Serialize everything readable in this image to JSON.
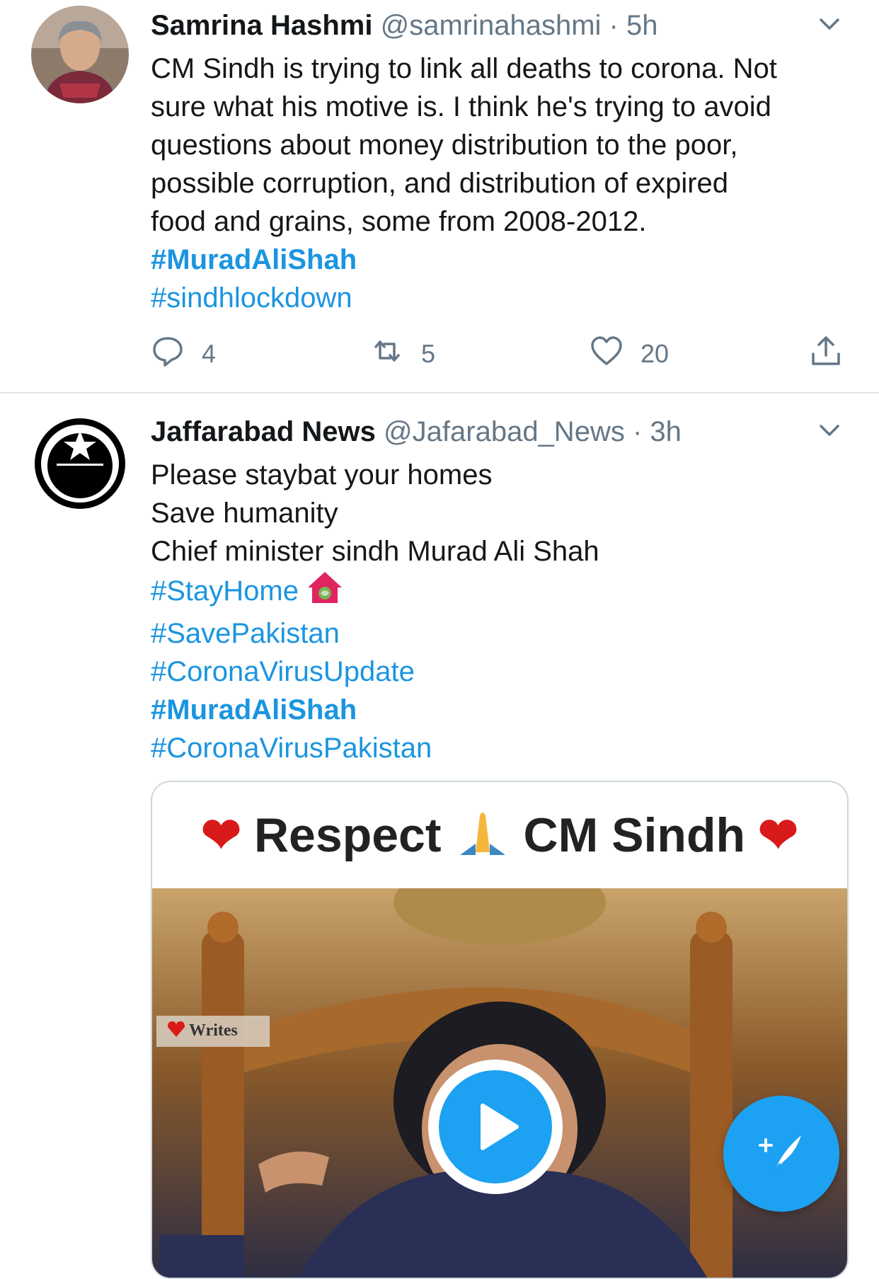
{
  "tweets": [
    {
      "name": "Samrina Hashmi",
      "handle": "@samrinahashmi",
      "separator": "·",
      "time": "5h",
      "lines": [
        "CM Sindh is trying to link all deaths to corona. Not",
        "sure what his motive is. I think he's trying to avoid",
        "questions about money distribution to the poor,",
        "possible corruption, and distribution of expired",
        "food and grains, some from 2008-2012."
      ],
      "hashtags": [
        "#MuradAliShah",
        "#sindhlockdown"
      ],
      "reply_count": "4",
      "retweet_count": "5",
      "like_count": "20"
    },
    {
      "name": "Jaffarabad News",
      "handle": "@Jafarabad_News",
      "separator": "·",
      "time": "3h",
      "lines": [
        "Please staybat your homes",
        "Save humanity",
        "Chief minister sindh Murad Ali Shah"
      ],
      "hashtags": [
        "#StayHome",
        "#SavePakistan",
        "#CoronaVirusUpdate",
        "#MuradAliShah",
        "#CoronaVirusPakistan"
      ],
      "media": {
        "title_word1": "Respect",
        "title_word2": "CM Sindh",
        "watermark": "Writes"
      }
    }
  ],
  "colors": {
    "link": "#1b95e0",
    "accent": "#1da1f2",
    "meta": "#657786",
    "heart": "#d91a1a"
  },
  "icons": [
    "chevron-down-icon",
    "reply-icon",
    "retweet-icon",
    "like-icon",
    "share-icon",
    "play-icon",
    "compose-icon"
  ]
}
